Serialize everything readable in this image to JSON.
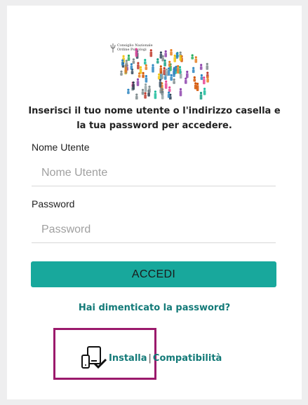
{
  "logo": {
    "line1": "Consiglio Nazionale",
    "line2": "Ordine Psicologi"
  },
  "intro_text": "Inserisci il tuo nome utente o l'indirizzo casella e la tua password per accedere.",
  "username": {
    "label": "Nome Utente",
    "placeholder": "Nome Utente",
    "value": ""
  },
  "password": {
    "label": "Password",
    "placeholder": "Password",
    "value": ""
  },
  "login_button": "ACCEDI",
  "forgot_link": "Hai dimenticato la password?",
  "install": {
    "icon": "devices-check-icon",
    "install_label": "Installa",
    "separator": "|",
    "compat_label": "Compatibilità"
  },
  "colors": {
    "accent": "#18a89c",
    "link": "#137a78",
    "highlight": "#9b1a6c"
  }
}
